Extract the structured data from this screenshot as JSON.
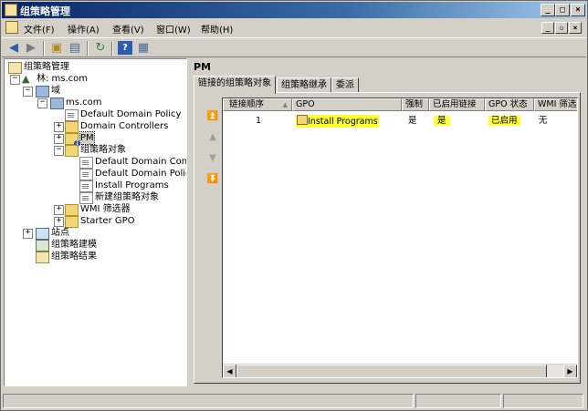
{
  "window": {
    "title": "组策略管理"
  },
  "menu": {
    "items": [
      "文件(F)",
      "操作(A)",
      "查看(V)",
      "窗口(W)",
      "帮助(H)"
    ]
  },
  "toolbar": {
    "icons": [
      "back-arrow-icon",
      "forward-arrow-icon",
      "up-folder-icon",
      "show-hide-tree-icon",
      "refresh-icon",
      "help-icon",
      "properties-icon"
    ]
  },
  "tree": {
    "root": "组策略管理",
    "forest": "林: ms.com",
    "domains": "域",
    "domain": "ms.com",
    "default_domain_policy": "Default Domain Policy",
    "domain_controllers": "Domain Controllers",
    "pm": "PM",
    "gpo_container": "组策略对象",
    "gpo_items": [
      "Default Domain Contr",
      "Default Domain Polic",
      "Install Programs",
      "新建组策略对象"
    ],
    "wmi_filters": "WMI 筛选器",
    "starter_gpo": "Starter GPO",
    "sites": "站点",
    "modeling": "组策略建模",
    "results": "组策略结果"
  },
  "details": {
    "title": "PM",
    "tabs": [
      "链接的组策略对象",
      "组策略继承",
      "委派"
    ],
    "active_tab": 0,
    "columns": [
      "链接顺序",
      "GPO",
      "强制",
      "已启用链接",
      "GPO 状态",
      "WMI 筛选"
    ],
    "sort_indicator": "▲",
    "rows": [
      {
        "link_order": "1",
        "gpo": "Install Programs",
        "enforced": "是",
        "link_enabled": "是",
        "gpo_status": "已启用",
        "wmi_filter": "无"
      }
    ],
    "highlight_color": "#ffff33"
  }
}
